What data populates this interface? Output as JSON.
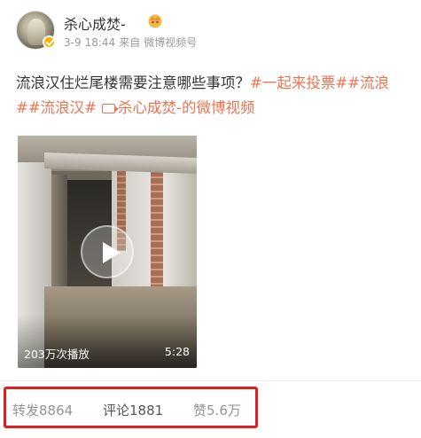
{
  "author": {
    "name": "杀心成焚-",
    "badge_icon": "crown-icon",
    "verified_icon": "verified-badge-icon"
  },
  "meta": {
    "date": "3-9",
    "time": "18:44",
    "source_prefix": "来自",
    "source": "微博视频号"
  },
  "post": {
    "text": "流浪汉住烂尾楼需要注意哪些事项？",
    "tags": [
      "#一起来投票#",
      "#流浪#",
      "#流浪汉#"
    ],
    "video_link_label": "杀心成焚-的微博视频",
    "video_link_icon": "video-icon"
  },
  "video": {
    "play_icon": "play-icon",
    "views": "203万次播放",
    "duration": "5:28"
  },
  "actions": {
    "repost_label": "转发",
    "repost_count": "8864",
    "comment_label": "评论",
    "comment_count": "1881",
    "like_label": "赞",
    "like_count": "5.6万"
  },
  "colors": {
    "link": "#eb7350",
    "highlight_box": "#e02020",
    "meta_gray": "#999999"
  }
}
